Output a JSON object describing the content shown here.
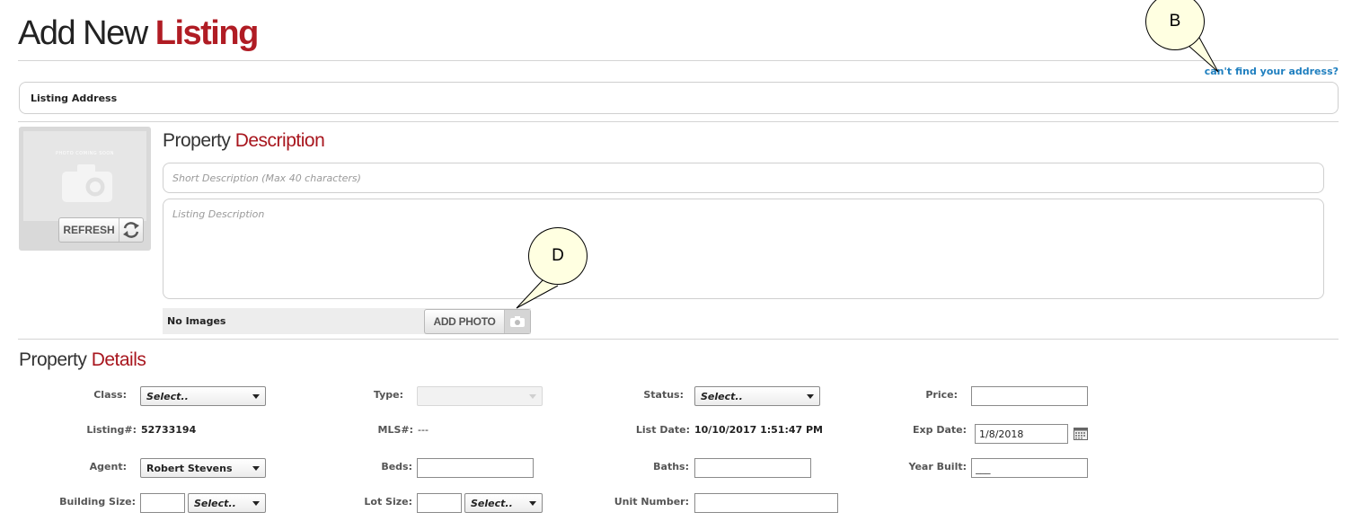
{
  "header": {
    "title_part1": "Add New ",
    "title_part2": "Listing"
  },
  "help_link": "can't find your address?",
  "address": {
    "label": "Listing Address"
  },
  "photo": {
    "placeholder_caption": "PHOTO COMING SOON",
    "refresh_label": "REFRESH",
    "refresh_icon": "refresh-icon"
  },
  "description": {
    "heading_part1": "Property ",
    "heading_part2": "Description",
    "short_placeholder": "Short Description (Max 40 characters)",
    "long_placeholder": "Listing Description",
    "images_label": "No Images",
    "add_photo_label": "ADD PHOTO",
    "add_photo_icon": "camera-icon"
  },
  "callouts": {
    "b": "B",
    "d": "D"
  },
  "details": {
    "heading_part1": "Property ",
    "heading_part2": "Details",
    "class": {
      "label": "Class:",
      "value": "Select.."
    },
    "type": {
      "label": "Type:",
      "value": ""
    },
    "status": {
      "label": "Status:",
      "value": "Select.."
    },
    "price": {
      "label": "Price:",
      "value": ""
    },
    "listing_num": {
      "label": "Listing#:",
      "value": "52733194"
    },
    "mls_num": {
      "label": "MLS#:",
      "value": "---"
    },
    "list_date": {
      "label": "List Date:",
      "value": "10/10/2017 1:51:47 PM"
    },
    "exp_date": {
      "label": "Exp Date:",
      "value": "1/8/2018",
      "icon": "calendar-icon"
    },
    "agent": {
      "label": "Agent:",
      "value": "Robert Stevens"
    },
    "beds": {
      "label": "Beds:",
      "value": ""
    },
    "baths": {
      "label": "Baths:",
      "value": ""
    },
    "year_built": {
      "label": "Year Built:",
      "value": "___"
    },
    "building_size": {
      "label": "Building Size:",
      "value": "",
      "unit": "Select.."
    },
    "lot_size": {
      "label": "Lot Size:",
      "value": "",
      "unit": "Select.."
    },
    "unit_number": {
      "label": "Unit Number:",
      "value": ""
    }
  }
}
